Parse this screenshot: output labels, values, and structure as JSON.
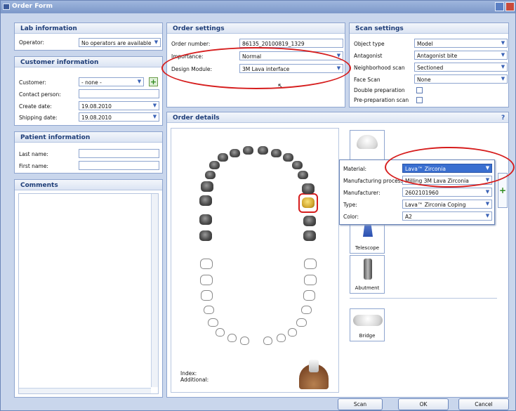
{
  "window": {
    "title": "Order Form"
  },
  "lab": {
    "title": "Lab information",
    "operator_label": "Operator:",
    "operator_value": "No operators are available"
  },
  "customer": {
    "title": "Customer information",
    "customer_label": "Customer:",
    "customer_value": "- none -",
    "contact_label": "Contact person:",
    "contact_value": "",
    "create_label": "Create date:",
    "create_value": "19.08.2010",
    "shipping_label": "Shipping date:",
    "shipping_value": "19.08.2010"
  },
  "patient": {
    "title": "Patient information",
    "last_label": "Last name:",
    "last_value": "",
    "first_label": "First name:",
    "first_value": ""
  },
  "comments": {
    "title": "Comments"
  },
  "order_settings": {
    "title": "Order settings",
    "number_label": "Order number:",
    "number_value": "86135_20100819_1329",
    "importance_label": "Importance:",
    "importance_value": "Normal",
    "module_label": "Design Module:",
    "module_value": "3M Lava interface"
  },
  "scan_settings": {
    "title": "Scan settings",
    "object_label": "Object type",
    "object_value": "Model",
    "antagonist_label": "Antagonist",
    "antagonist_value": "Antagonist bite",
    "neighborhood_label": "Neighborhood scan",
    "neighborhood_value": "Sectioned",
    "face_label": "Face Scan",
    "face_value": "None",
    "double_label": "Double preparation",
    "prep_label": "Pre-preparation scan"
  },
  "order_details": {
    "title": "Order details",
    "help": "?",
    "index_label": "Index:",
    "additional_label": "Additional:"
  },
  "tiles": {
    "telescope": "Telescope",
    "abutment": "Abutment",
    "bridge": "Bridge"
  },
  "material_popup": {
    "material_label": "Material:",
    "material_value": "Lava™ Zirconia",
    "process_label": "Manufacturing process:",
    "process_value": "Milling 3M Lava Zirconia",
    "manufacturer_label": "Manufacturer:",
    "manufacturer_value": "2602101960",
    "type_label": "Type:",
    "type_value": "Lava™ Zirconia Coping",
    "color_label": "Color:",
    "color_value": "A2"
  },
  "buttons": {
    "scan": "Scan",
    "ok": "OK",
    "cancel": "Cancel"
  },
  "colors": {
    "highlight_ring": "#d61d1d",
    "selection": "#3a6fd0",
    "header_text": "#1e3d77"
  }
}
